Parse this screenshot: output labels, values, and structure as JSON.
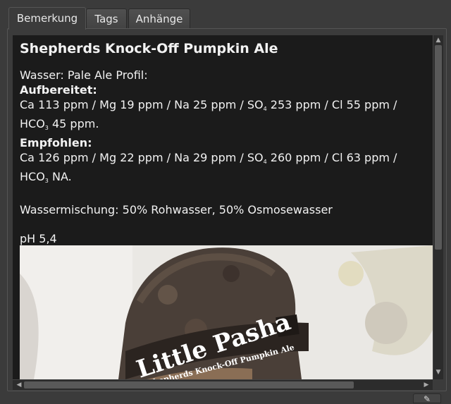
{
  "tabs": [
    {
      "label": "Bemerkung",
      "active": true
    },
    {
      "label": "Tags",
      "active": false
    },
    {
      "label": "Anhänge",
      "active": false
    }
  ],
  "note": {
    "title": "Shepherds Knock-Off Pumpkin Ale",
    "water_profile": "Wasser: Pale Ale Profil:",
    "treated_label": "Aufbereitet:",
    "treated_line1": {
      "pre": "Ca 113 ppm / Mg 19 ppm / Na 25 ppm / SO",
      "sub": "4",
      "post": " 253 ppm / Cl 55 ppm /"
    },
    "treated_line2": {
      "pre": "HCO",
      "sub": "3",
      "post": " 45 ppm."
    },
    "recommended_label": "Empfohlen:",
    "recommended_line1": {
      "pre": "Ca 126 ppm / Mg 22 ppm / Na 29 ppm / SO",
      "sub": "4",
      "post": " 260 ppm / Cl 63 ppm /"
    },
    "recommended_line2": {
      "pre": "HCO",
      "sub": "3",
      "post": " NA."
    },
    "water_mix": "Wassermischung: 50% Rohwasser, 50% Osmosewasser",
    "ph": "pH 5,4"
  },
  "image": {
    "logo_line1": "Little Pasha",
    "logo_line2": "Shepherds Knock-Off Pumpkin Ale"
  },
  "icons": {
    "scroll_up": "chevron-up-icon",
    "scroll_down": "chevron-down-icon",
    "scroll_left": "chevron-left-icon",
    "scroll_right": "chevron-right-icon",
    "edit": "pencil-icon"
  },
  "colors": {
    "background": "#3b3b3b",
    "viewer": "#1b1b1b",
    "text": "#f2f2f2"
  }
}
